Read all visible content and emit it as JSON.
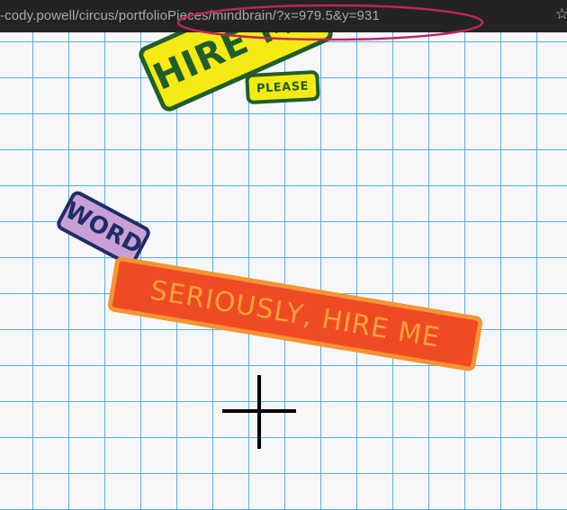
{
  "browser": {
    "url_visible": "-cody.powell/circus/portfolioPieces/mindbrain/?x=979.5&y=931",
    "bookmark_icon": "star-icon",
    "highlight_color": "#c0245a"
  },
  "canvas": {
    "background_color": "#f7f7f9",
    "grid_color": "#3aa0e6"
  },
  "stickers": {
    "hire_me": {
      "label": "HIRE ME",
      "fill": "#f5ea14",
      "border": "#1f5e2a"
    },
    "please": {
      "label": "PLEASE",
      "fill": "#f5ea14",
      "border": "#1f5e2a"
    },
    "word": {
      "label": "WORD",
      "fill": "#c9a0d6",
      "border": "#1f2c66"
    },
    "seriously": {
      "label": "SERIOUSLY, HIRE ME",
      "fill": "#ef4a24",
      "border": "#f49433"
    }
  },
  "cursor": {
    "icon": "crosshair-icon"
  }
}
